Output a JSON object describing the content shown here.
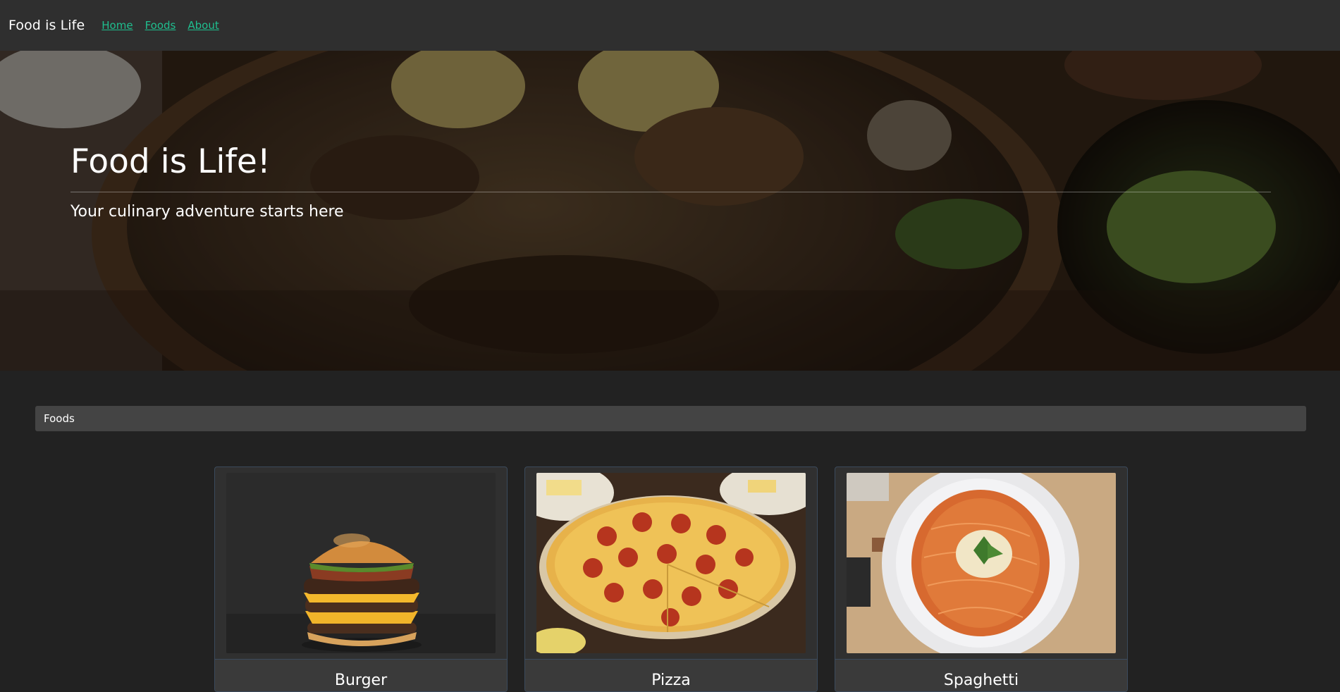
{
  "navbar": {
    "brand": "Food is Life",
    "links": [
      "Home",
      "Foods",
      "About"
    ]
  },
  "hero": {
    "title": "Food is Life!",
    "subtitle": "Your culinary adventure starts here"
  },
  "breadcrumb": {
    "label": "Foods"
  },
  "foods": [
    {
      "name": "Burger",
      "image": "burger-photo"
    },
    {
      "name": "Pizza",
      "image": "pizza-photo"
    },
    {
      "name": "Spaghetti",
      "image": "spaghetti-photo"
    }
  ],
  "colors": {
    "navbar": "#2f2f2f",
    "background": "#222222",
    "link": "#1fbf8f",
    "breadcrumb": "#444444",
    "card_border": "#3b4a5c"
  }
}
